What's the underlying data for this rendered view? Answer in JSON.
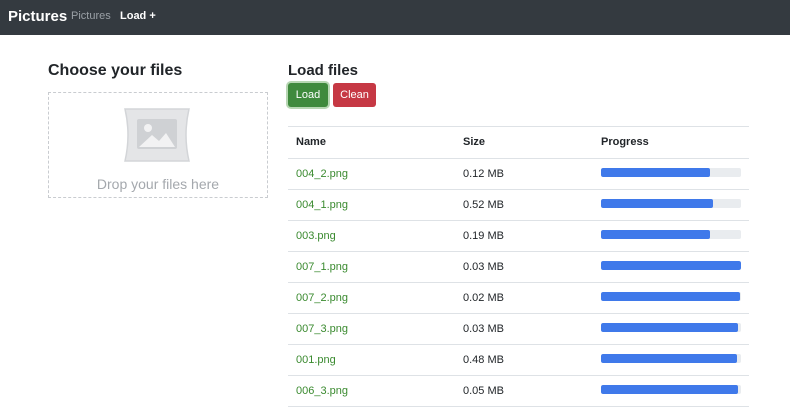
{
  "navbar": {
    "brand": "Pictures",
    "links": [
      {
        "label": "Pictures"
      },
      {
        "label": "Load +"
      }
    ],
    "background_color": "#343a40"
  },
  "left": {
    "title": "Choose your files",
    "dropzone_text": "Drop your files here",
    "icon": "image-placeholder-icon"
  },
  "right": {
    "title": "Load files",
    "buttons": {
      "load_label": "Load",
      "clean_label": "Clean"
    },
    "table": {
      "headers": [
        "Name",
        "Size",
        "Progress"
      ],
      "rows": [
        {
          "name": "004_2.png",
          "size": "0.12 MB",
          "progress": 0.78
        },
        {
          "name": "004_1.png",
          "size": "0.52 MB",
          "progress": 0.8
        },
        {
          "name": "003.png",
          "size": "0.19 MB",
          "progress": 0.78
        },
        {
          "name": "007_1.png",
          "size": "0.03 MB",
          "progress": 1.0
        },
        {
          "name": "007_2.png",
          "size": "0.02 MB",
          "progress": 0.99
        },
        {
          "name": "007_3.png",
          "size": "0.03 MB",
          "progress": 0.98
        },
        {
          "name": "001.png",
          "size": "0.48 MB",
          "progress": 0.97
        },
        {
          "name": "006_3.png",
          "size": "0.05 MB",
          "progress": 0.98
        }
      ]
    }
  },
  "colors": {
    "load_button": "#3f8a3d",
    "clean_button": "#c63844",
    "link": "#3a8a2f",
    "progress_bar": "#3f79ea"
  }
}
